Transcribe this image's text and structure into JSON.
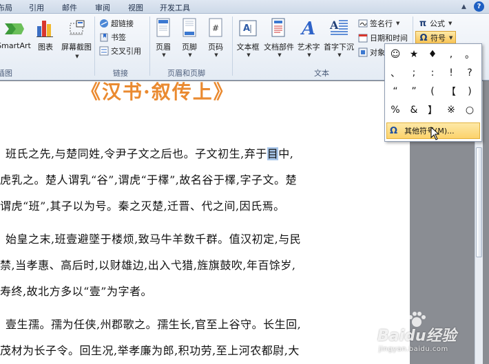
{
  "menu": {
    "tabs": [
      "布局",
      "引用",
      "邮件",
      "审阅",
      "视图",
      "开发工具"
    ],
    "help_label": "?"
  },
  "ribbon": {
    "illustrations": {
      "smartart_label": "SmartArt",
      "chart_label": "图表",
      "screenshot_label": "屏幕截图",
      "group_label": "插图"
    },
    "links": {
      "hyperlink_label": "超链接",
      "bookmark_label": "书签",
      "crossref_label": "交叉引用",
      "group_label": "链接"
    },
    "header_footer": {
      "header_label": "页眉",
      "footer_label": "页脚",
      "pagenum_label": "页码",
      "pagenum_icon_text": "#",
      "group_label": "页眉和页脚"
    },
    "text": {
      "textbox_label": "文本框",
      "docparts_label": "文档部件",
      "wordart_label": "艺术字",
      "dropcap_label": "首字下沉",
      "signature_label": "签名行",
      "datetime_label": "日期和时间",
      "object_label": "对象",
      "group_label": "文本"
    },
    "symbols": {
      "equation_label": "公式",
      "equation_icon_text": "π",
      "symbol_label": "符号",
      "symbol_icon_text": "Ω"
    }
  },
  "symbol_menu": {
    "symbols": [
      "☺",
      "★",
      "♦",
      ",",
      "。",
      "、",
      ";",
      ":",
      "!",
      "?",
      "“",
      "”",
      "(",
      "【",
      ")",
      "%",
      "&",
      "】",
      "※",
      "○"
    ],
    "more_symbols_label": "其他符号(M)..."
  },
  "document": {
    "title": "《汉书·叙传上》",
    "lines": [
      [
        "班氏之先,与楚同姓,令尹子文之后也。子文初生,弃于",
        "目",
        "中,"
      ],
      [
        "虎乳之。楚人谓乳“谷”,谓虎“于檡”,故名谷于檡,字子文。楚"
      ],
      [
        "谓虎“班”,其子以为号。秦之灭楚,迁晋、代之间,因氏焉。"
      ],
      [
        "始皇之末,班壹避墜于楼烦,致马牛羊数千群。值汉初定,与民"
      ],
      [
        "禁,当孝惠、高后时,以财雄边,出入弋猎,旌旗鼓吹,年百馀岁,"
      ],
      [
        "寿终,故北方多以“壹”为字者。"
      ],
      [
        "壹生孺。孺为任侠,州郡歌之。孺生长,官至上谷守。长生回,"
      ],
      [
        "茂材为长子令。回生况,举孝廉为郎,积功劳,至上河农都尉,大"
      ]
    ]
  },
  "watermark": {
    "text": "Baidu经验",
    "url": "jingyan.baidu.com"
  },
  "colors": {
    "title_orange": "#ea8a30",
    "selection_blue": "#a8c6ea",
    "menu_highlight": "#fcd26b"
  }
}
